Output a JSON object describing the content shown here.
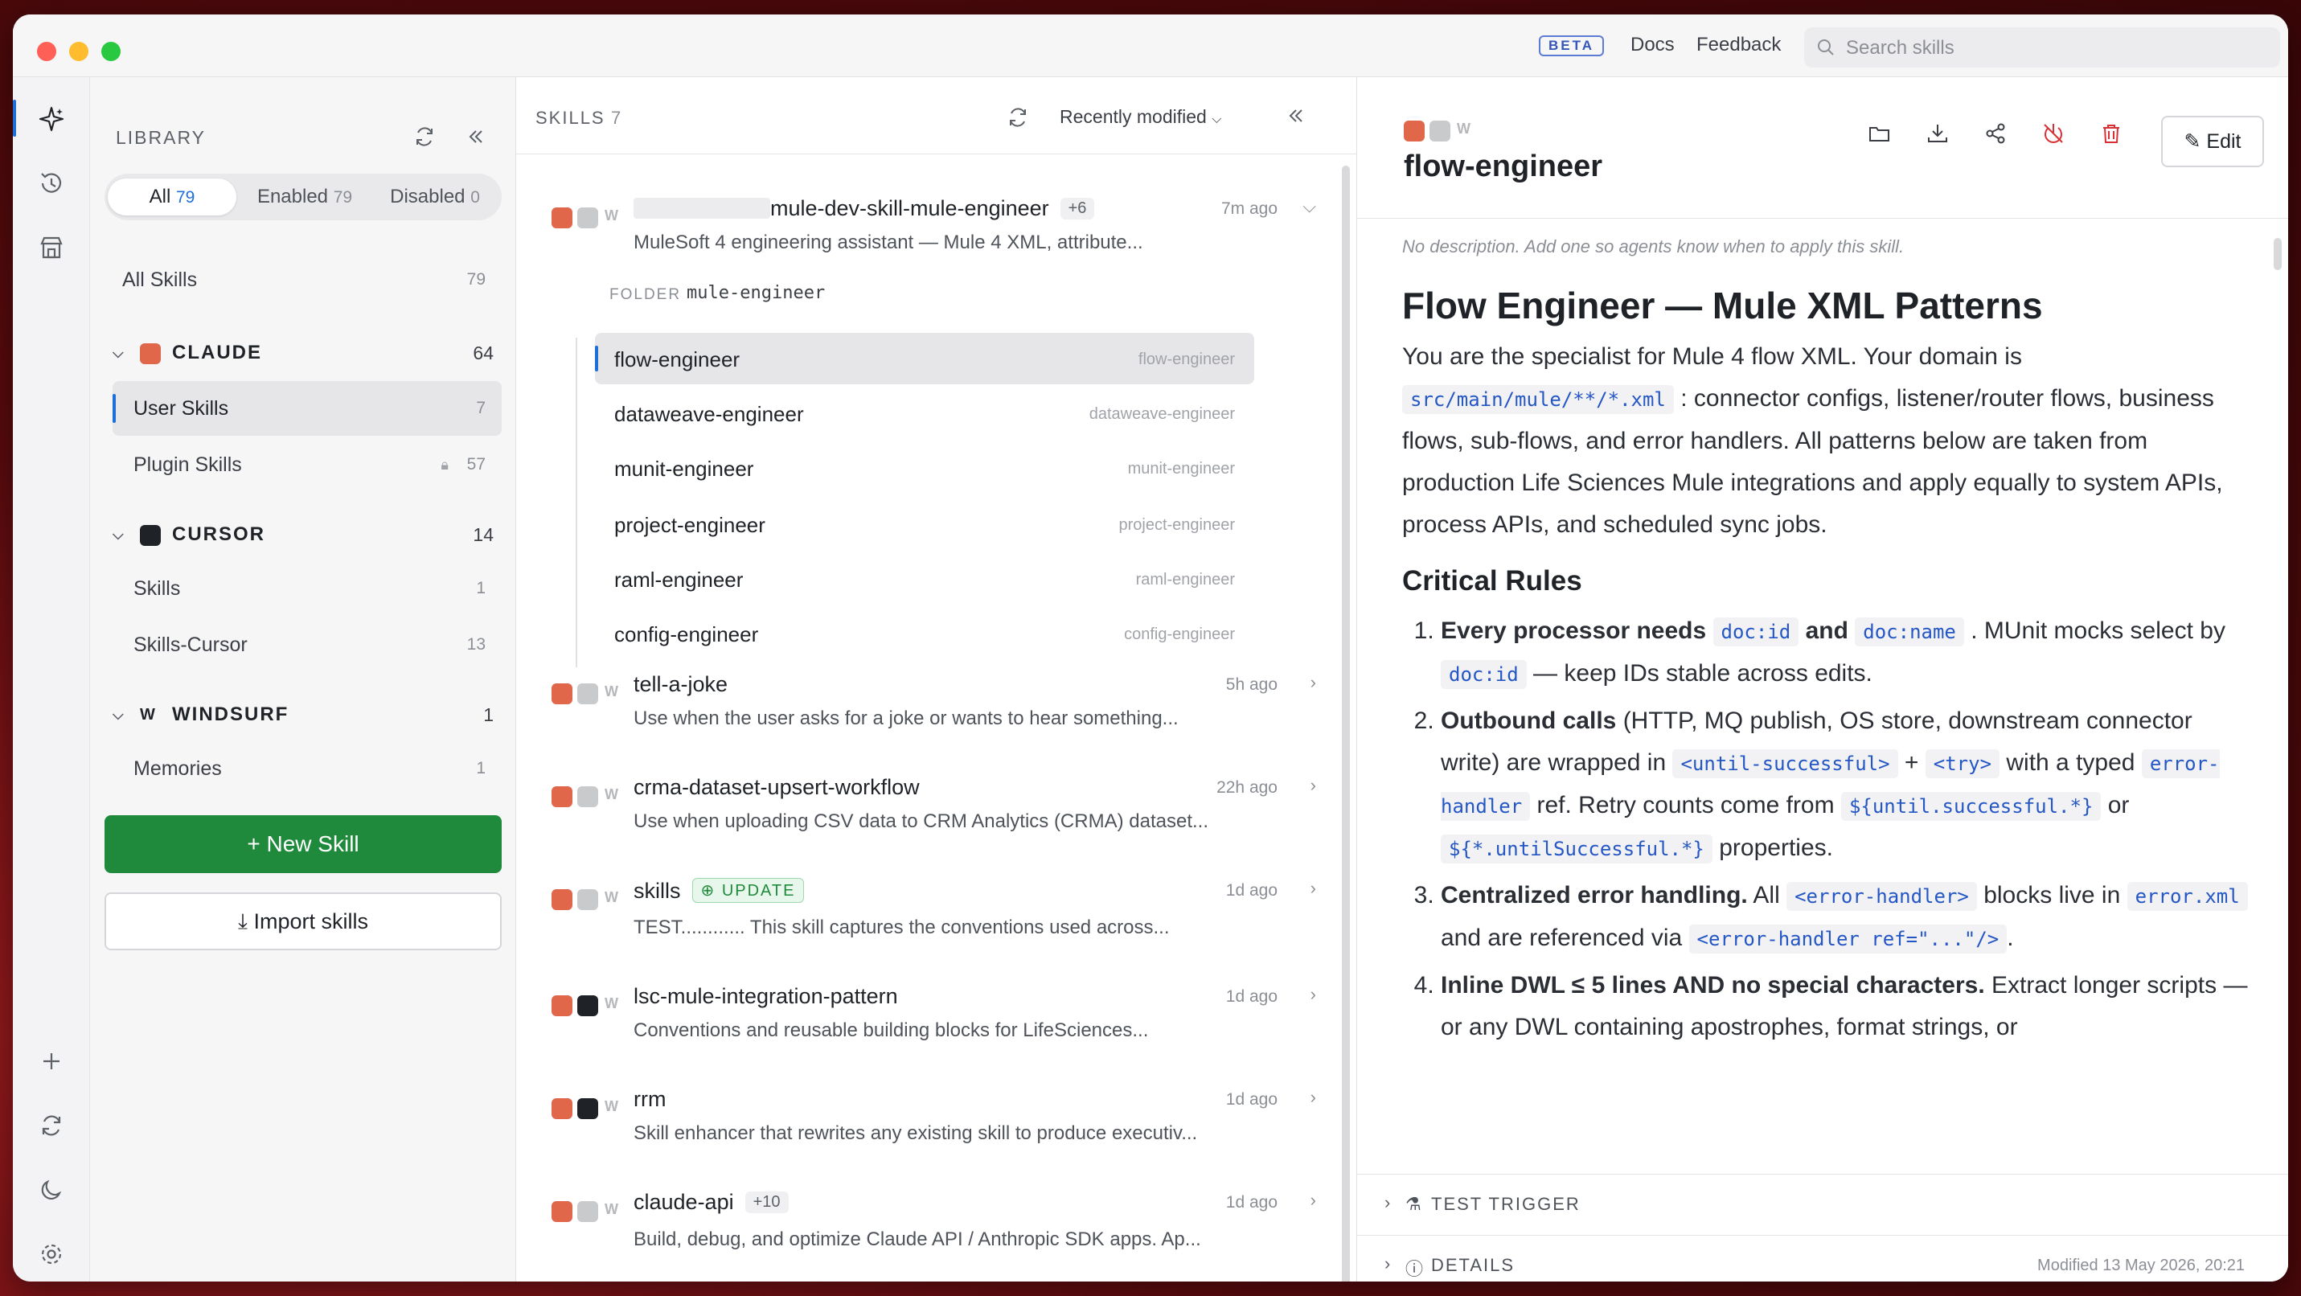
{
  "titlebar": {
    "beta": "BETA",
    "docs": "Docs",
    "feedback": "Feedback",
    "search_placeholder": "Search skills"
  },
  "library": {
    "heading": "LIBRARY",
    "filters": [
      {
        "label": "All",
        "count": "79"
      },
      {
        "label": "Enabled",
        "count": "79"
      },
      {
        "label": "Disabled",
        "count": "0"
      }
    ],
    "all_skills": {
      "label": "All Skills",
      "count": "79"
    },
    "groups": [
      {
        "name": "CLAUDE",
        "count": "64",
        "items": [
          {
            "label": "User Skills",
            "count": "7"
          },
          {
            "label": "Plugin Skills",
            "count": "57"
          }
        ]
      },
      {
        "name": "CURSOR",
        "count": "14",
        "items": [
          {
            "label": "Skills",
            "count": "1"
          },
          {
            "label": "Skills-Cursor",
            "count": "13"
          }
        ]
      },
      {
        "name": "WINDSURF",
        "count": "1",
        "items": [
          {
            "label": "Memories",
            "count": "1"
          }
        ]
      }
    ],
    "new_skill": "New Skill",
    "import_skills": "Import skills"
  },
  "skills": {
    "heading": "SKILLS",
    "count": "7",
    "sort": "Recently modified",
    "expanded": {
      "title": "mule-dev-skill-mule-engineer",
      "tag": "+6",
      "time": "7m ago",
      "desc": "MuleSoft 4 engineering assistant — Mule 4 XML, attribute...",
      "folder_label": "FOLDER",
      "folder": "mule-engineer",
      "subs": [
        {
          "name": "flow-engineer",
          "path": "flow-engineer"
        },
        {
          "name": "dataweave-engineer",
          "path": "dataweave-engineer"
        },
        {
          "name": "munit-engineer",
          "path": "munit-engineer"
        },
        {
          "name": "project-engineer",
          "path": "project-engineer"
        },
        {
          "name": "raml-engineer",
          "path": "raml-engineer"
        },
        {
          "name": "config-engineer",
          "path": "config-engineer"
        }
      ]
    },
    "items": [
      {
        "title": "tell-a-joke",
        "time": "5h ago",
        "desc": "Use when the user asks for a joke or wants to hear something..."
      },
      {
        "title": "crma-dataset-upsert-workflow",
        "time": "22h ago",
        "desc": "Use when uploading CSV data to CRM Analytics (CRMA) dataset..."
      },
      {
        "title": "skills",
        "badge": "UPDATE",
        "time": "1d ago",
        "desc": "TEST............ This skill captures the conventions used across..."
      },
      {
        "title": "lsc-mule-integration-pattern",
        "time": "1d ago",
        "desc": "Conventions and reusable building blocks for LifeSciences..."
      },
      {
        "title": "rrm",
        "time": "1d ago",
        "desc": "Skill enhancer that rewrites any existing skill to produce executiv..."
      },
      {
        "title": "claude-api",
        "tag": "+10",
        "time": "1d ago",
        "desc": "Build, debug, and optimize Claude API / Anthropic SDK apps. Ap..."
      }
    ]
  },
  "detail": {
    "title": "flow-engineer",
    "edit": "Edit",
    "no_description": "No description. Add one so agents know when to apply this skill.",
    "h1": "Flow Engineer — Mule XML Patterns",
    "intro_a": "You are the specialist for Mule 4 flow XML. Your domain is",
    "intro_code": "src/main/mule/**/*.xml",
    "intro_b": ": connector configs, listener/router flows, business flows, sub-flows, and error handlers. All patterns below are taken from production Life Sciences Mule integrations and apply equally to system APIs, process APIs, and scheduled sync jobs.",
    "h2": "Critical Rules",
    "rules": {
      "r1_bold": "Every processor needs",
      "r1_c1": "doc:id",
      "r1_and": "and",
      "r1_c2": "doc:name",
      "r1_rest": ". MUnit mocks select by",
      "r1_c3": "doc:id",
      "r1_tail": "— keep IDs stable across edits.",
      "r2_bold": "Outbound calls",
      "r2_a": "(HTTP, MQ publish, OS store, downstream connector write) are wrapped in",
      "r2_c1": "<until-successful>",
      "r2_plus": "+",
      "r2_c2": "<try>",
      "r2_b": "with a typed",
      "r2_c3": "error-handler",
      "r2_c": "ref. Retry counts come from",
      "r2_c4": "${until.successful.*}",
      "r2_or": "or",
      "r2_c5": "${*.untilSuccessful.*}",
      "r2_d": "properties.",
      "r3_bold": "Centralized error handling.",
      "r3_a": "All",
      "r3_c1": "<error-handler>",
      "r3_b": "blocks live in",
      "r3_c2": "error.xml",
      "r3_c": "and are referenced via",
      "r3_c3": "<error-handler ref=\"...\"/>",
      "r3_d": ".",
      "r4_bold": "Inline DWL ≤ 5 lines AND no special characters.",
      "r4_a": "Extract longer scripts — or any DWL containing apostrophes, format strings, or"
    },
    "test_trigger": "TEST TRIGGER",
    "details": "DETAILS",
    "modified": "Modified 13 May 2026, 20:21"
  }
}
